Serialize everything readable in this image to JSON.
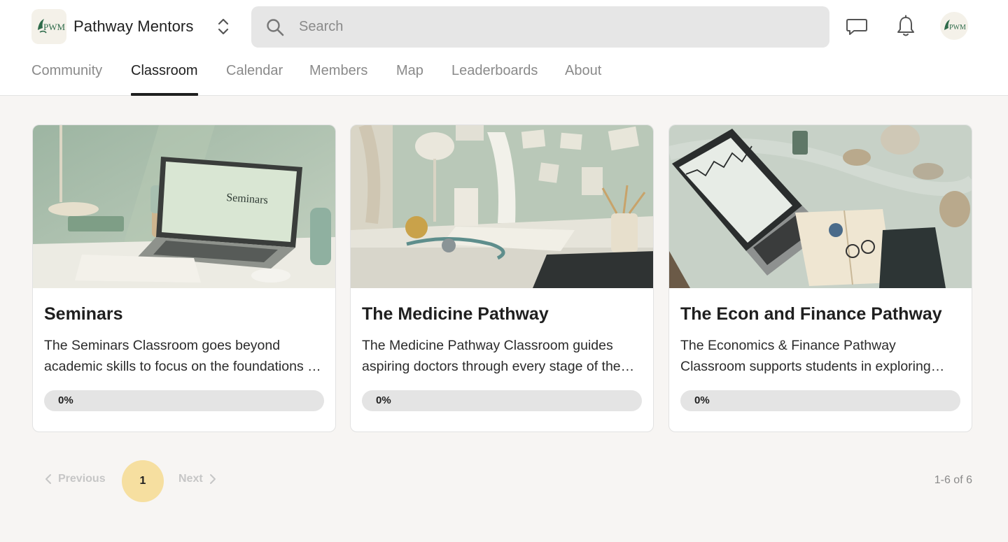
{
  "header": {
    "group_name": "Pathway Mentors",
    "logo_text": "PWM",
    "search_placeholder": "Search",
    "icons": {
      "switcher": "chevron-up-down-icon",
      "search": "search-icon",
      "chat": "chat-icon",
      "notifications": "bell-icon",
      "avatar": "avatar"
    }
  },
  "nav": {
    "tabs": [
      {
        "label": "Community",
        "active": false
      },
      {
        "label": "Classroom",
        "active": true
      },
      {
        "label": "Calendar",
        "active": false
      },
      {
        "label": "Members",
        "active": false
      },
      {
        "label": "Map",
        "active": false
      },
      {
        "label": "Leaderboards",
        "active": false
      },
      {
        "label": "About",
        "active": false
      }
    ]
  },
  "courses": [
    {
      "title": "Seminars",
      "description": "The Seminars Classroom goes beyond academic skills to focus on the foundations of personal and professional growth.",
      "progress_label": "0%",
      "progress": 0,
      "thumb_text": "Seminars"
    },
    {
      "title": "The Medicine Pathway",
      "description": "The Medicine Pathway Classroom guides aspiring doctors through every stage of the journey to medical school.",
      "progress_label": "0%",
      "progress": 0
    },
    {
      "title": "The Econ and Finance Pathway",
      "description": "The Economics & Finance Pathway Classroom supports students in exploring economics and finance careers.",
      "progress_label": "0%",
      "progress": 0
    }
  ],
  "pagination": {
    "previous_label": "Previous",
    "next_label": "Next",
    "current_page": "1",
    "count_label": "1-6 of 6"
  },
  "colors": {
    "accent": "#f6dfa0",
    "active_tab": "#1f1f1f",
    "inactive_tab": "#8a8a8a",
    "page_bg": "#f7f5f3"
  }
}
